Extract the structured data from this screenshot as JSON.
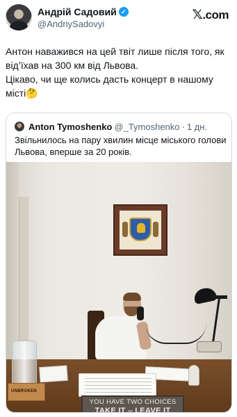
{
  "author": {
    "name": "Андрій Садовий",
    "handle": "@AndriySadovyi",
    "verified": true
  },
  "brand": {
    "logo_text": ".com",
    "logo_glyph": "𝕏"
  },
  "tweet": {
    "line1": "Антон наважився на цей твіт лише після того, як від’їхав на 300 км від Львова.",
    "line2": "Цікаво, чи ще колись дасть концерт в нашому місті",
    "line2_emoji": "🤔"
  },
  "quoted": {
    "name": "Anton Tymoshenko",
    "handle": "@_Tymoshenko",
    "separator": "·",
    "time": "1 дн.",
    "text": "Звільнилось на пару хвилин місце міського голови Львова, вперше за 20 років."
  },
  "photo": {
    "jar_label": "UNBROKEN",
    "sign_line1": "YOU HAVE TWO CHOICES",
    "sign_line2_left": "TAKE IT",
    "sign_line2_or": "or",
    "sign_line2_right": "LEAVE IT"
  },
  "colors": {
    "verified": "#1d9bf0",
    "secondary_text": "#536471",
    "border": "#cfd9de"
  },
  "icons": [
    "verified-badge-icon",
    "x-logo-icon"
  ]
}
